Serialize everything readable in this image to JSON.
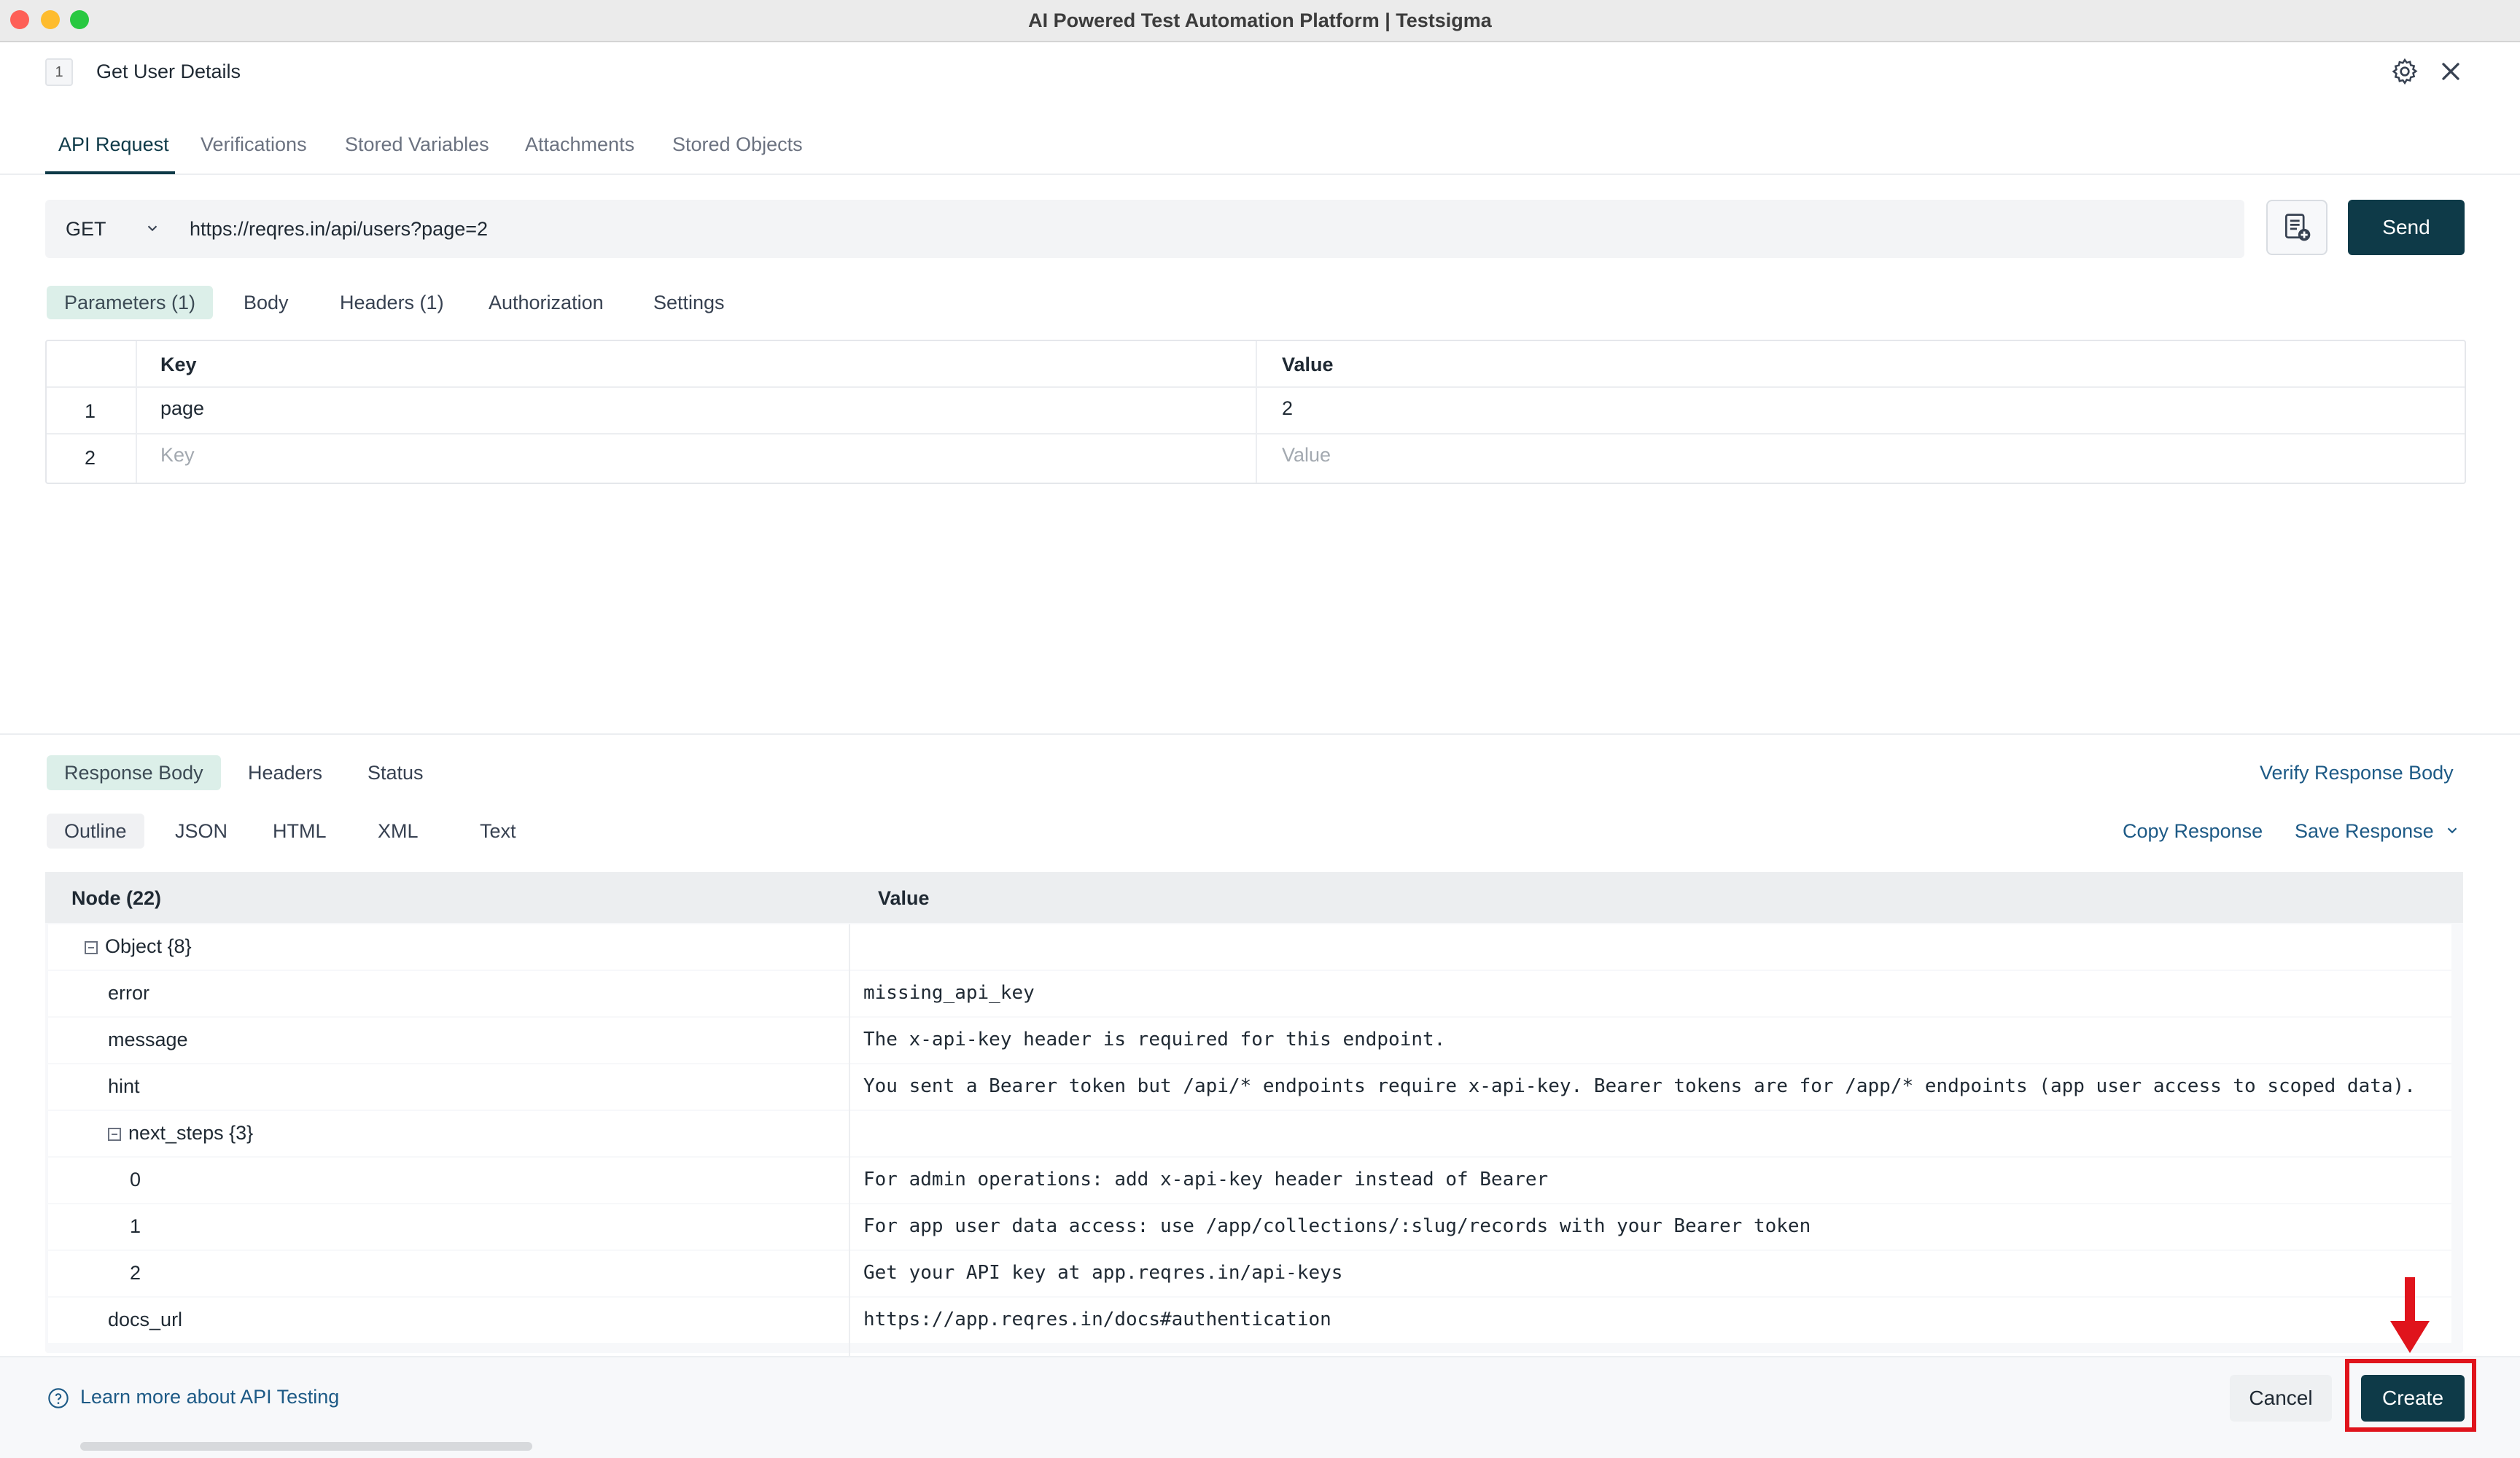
{
  "window": {
    "title": "AI Powered Test Automation Platform | Testsigma",
    "traffic_lights": [
      "#fe5f57",
      "#febc2e",
      "#28c840"
    ]
  },
  "header": {
    "step_number": "1",
    "title": "Get User Details",
    "settings_icon": "gear-icon",
    "close_icon": "close-icon"
  },
  "main_tabs": [
    {
      "label": "API Request",
      "active": true
    },
    {
      "label": "Verifications"
    },
    {
      "label": "Stored Variables"
    },
    {
      "label": "Attachments"
    },
    {
      "label": "Stored Objects"
    }
  ],
  "request": {
    "method": "GET",
    "url": "https://reqres.in/api/users?page=2",
    "send_label": "Send"
  },
  "request_tabs": [
    {
      "label": "Parameters (1)",
      "active": true
    },
    {
      "label": "Body"
    },
    {
      "label": "Headers (1)"
    },
    {
      "label": "Authorization"
    },
    {
      "label": "Settings"
    }
  ],
  "params_table": {
    "headers": {
      "key": "Key",
      "value": "Value"
    },
    "rows": [
      {
        "num": "1",
        "key": "page",
        "value": "2"
      },
      {
        "num": "2",
        "key_placeholder": "Key",
        "value_placeholder": "Value"
      }
    ]
  },
  "response_tabs": [
    {
      "label": "Response Body",
      "active": true
    },
    {
      "label": "Headers"
    },
    {
      "label": "Status"
    }
  ],
  "verify_link": "Verify Response Body",
  "format_tabs": [
    {
      "label": "Outline",
      "active": true
    },
    {
      "label": "JSON"
    },
    {
      "label": "HTML"
    },
    {
      "label": "XML"
    },
    {
      "label": "Text"
    }
  ],
  "copy_response": "Copy Response",
  "save_response": "Save Response",
  "response_grid": {
    "headers": {
      "node": "Node (22)",
      "value": "Value"
    },
    "rows": [
      {
        "node": "Object {8}",
        "value": ""
      },
      {
        "node": "error",
        "value": "missing_api_key"
      },
      {
        "node": "message",
        "value": "The x-api-key header is required for this endpoint."
      },
      {
        "node": "hint",
        "value": "You sent a Bearer token but /api/* endpoints require x-api-key. Bearer tokens are for /app/* endpoints (app user access to scoped data)."
      },
      {
        "node": "next_steps {3}",
        "value": ""
      },
      {
        "node": "0",
        "value": "For admin operations: add x-api-key header instead of Bearer"
      },
      {
        "node": "1",
        "value": "For app user data access: use /app/collections/:slug/records with your Bearer token"
      },
      {
        "node": "2",
        "value": "Get your API key at app.reqres.in/api-keys"
      },
      {
        "node": "docs_url",
        "value": "https://app.reqres.in/docs#authentication"
      }
    ]
  },
  "footer": {
    "learn_more": "Learn more about API Testing",
    "cancel": "Cancel",
    "create": "Create"
  },
  "colors": {
    "primary": "#0e3a48",
    "link": "#1d5a86",
    "highlight": "#e0141c",
    "active_tab_bg": "#dcefe9"
  }
}
